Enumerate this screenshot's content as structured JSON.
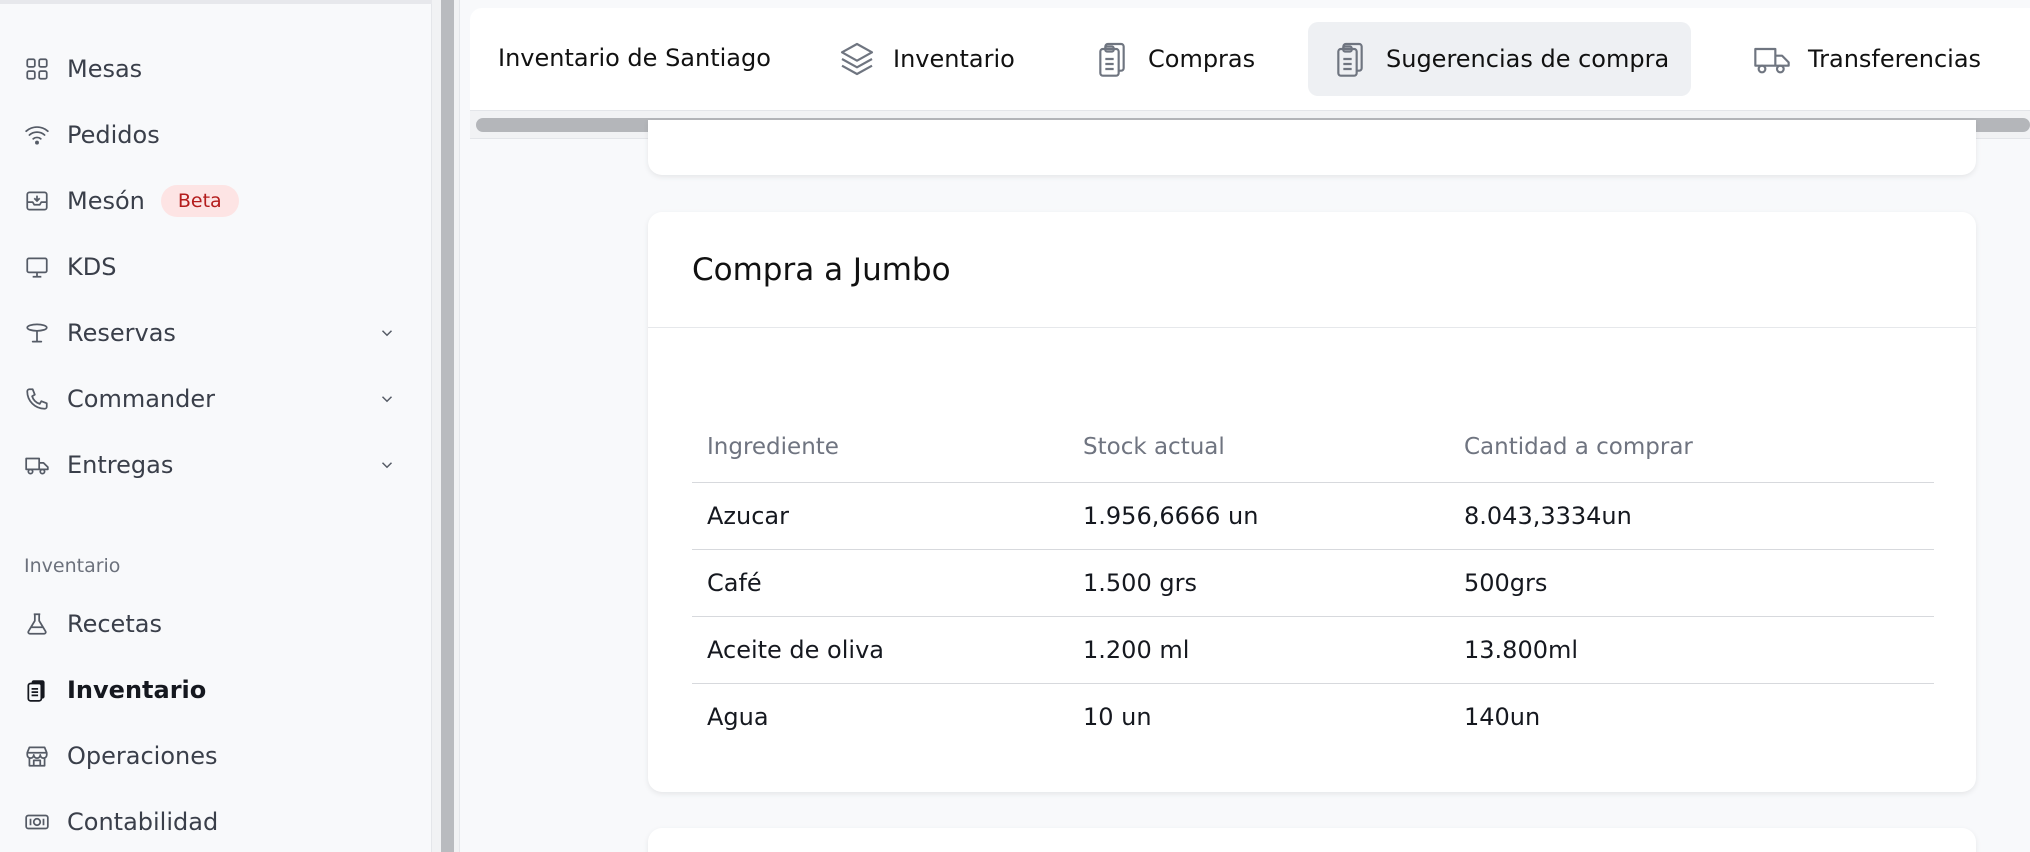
{
  "sidebar": {
    "items": [
      {
        "label": "Mesas",
        "icon": "grid-icon"
      },
      {
        "label": "Pedidos",
        "icon": "wifi-icon"
      },
      {
        "label": "Mesón",
        "icon": "inbox-icon",
        "badge": "Beta"
      },
      {
        "label": "KDS",
        "icon": "monitor-icon"
      },
      {
        "label": "Reservas",
        "icon": "table-icon"
      },
      {
        "label": "Commander",
        "icon": "phone-icon"
      },
      {
        "label": "Entregas",
        "icon": "truck-icon"
      }
    ],
    "section_label": "Inventario",
    "section_items": [
      {
        "label": "Recetas",
        "icon": "flask-icon"
      },
      {
        "label": "Inventario",
        "icon": "clipboard-icon",
        "active": true
      },
      {
        "label": "Operaciones",
        "icon": "store-icon"
      },
      {
        "label": "Contabilidad",
        "icon": "cash-icon"
      }
    ]
  },
  "topbar": {
    "context": "Inventario de Santiago",
    "tabs": [
      {
        "label": "Inventario",
        "icon": "layers-icon"
      },
      {
        "label": "Compras",
        "icon": "clipboard-icon"
      },
      {
        "label": "Sugerencias de compra",
        "icon": "clipboard-icon",
        "active": true
      },
      {
        "label": "Transferencias",
        "icon": "truck-icon"
      }
    ]
  },
  "card": {
    "title": "Compra a Jumbo",
    "columns": [
      "Ingrediente",
      "Stock actual",
      "Cantidad a comprar"
    ],
    "rows": [
      [
        "Azucar",
        "1.956,6666 un",
        "8.043,3334un"
      ],
      [
        "Café",
        "1.500 grs",
        "500grs"
      ],
      [
        "Aceite de oliva",
        "1.200 ml",
        "13.800ml"
      ],
      [
        "Agua",
        "10 un",
        "140un"
      ]
    ]
  }
}
